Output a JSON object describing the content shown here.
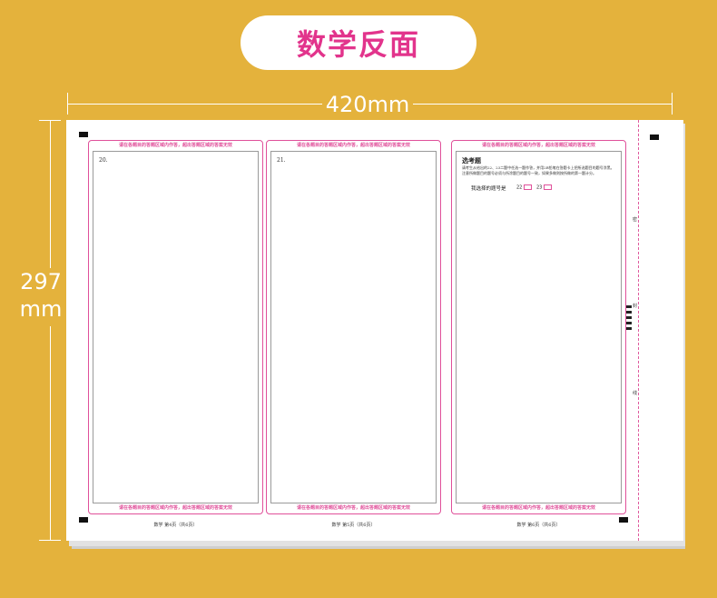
{
  "header": {
    "title": "数学反面"
  },
  "dimensions": {
    "width_label": "420mm",
    "height_line1": "297",
    "height_line2": "mm"
  },
  "sheet": {
    "boundary_note": "请在各题目的答题区域内作答，超出答题区域的答案无效",
    "columns": [
      {
        "question": "20.",
        "footer": "数学 第4页（共6页）"
      },
      {
        "question": "21.",
        "footer": "数学 第5页（共6页）"
      },
      {
        "question": "",
        "footer": "数学 第6页（共6页）",
        "optional": {
          "title": "选考题",
          "instructions": "请考生从给出的22、23二题中任选一题作答，并用2B铅笔在答题卡上把所选题目的题号涂黑。注意所做题目的题号必须与所涂题目的题号一致，如果多做则按所做的第一题计分。",
          "choice_label": "我选择的题号是",
          "options": [
            "22",
            "23"
          ]
        }
      }
    ],
    "seal_chars": [
      "密",
      "封",
      "线"
    ]
  }
}
